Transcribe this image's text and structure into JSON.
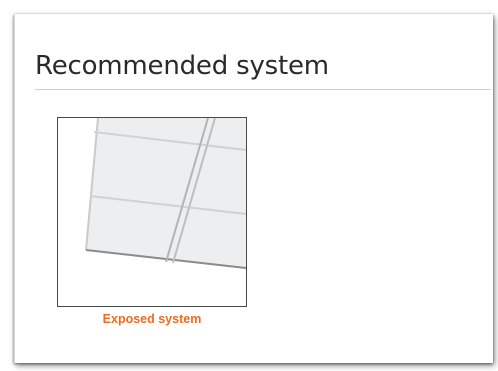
{
  "section": {
    "title": "Recommended system"
  },
  "system_option": {
    "caption": "Exposed system",
    "icon": "exposed-ceiling-grid-icon",
    "caption_color": "#f26a1b"
  }
}
